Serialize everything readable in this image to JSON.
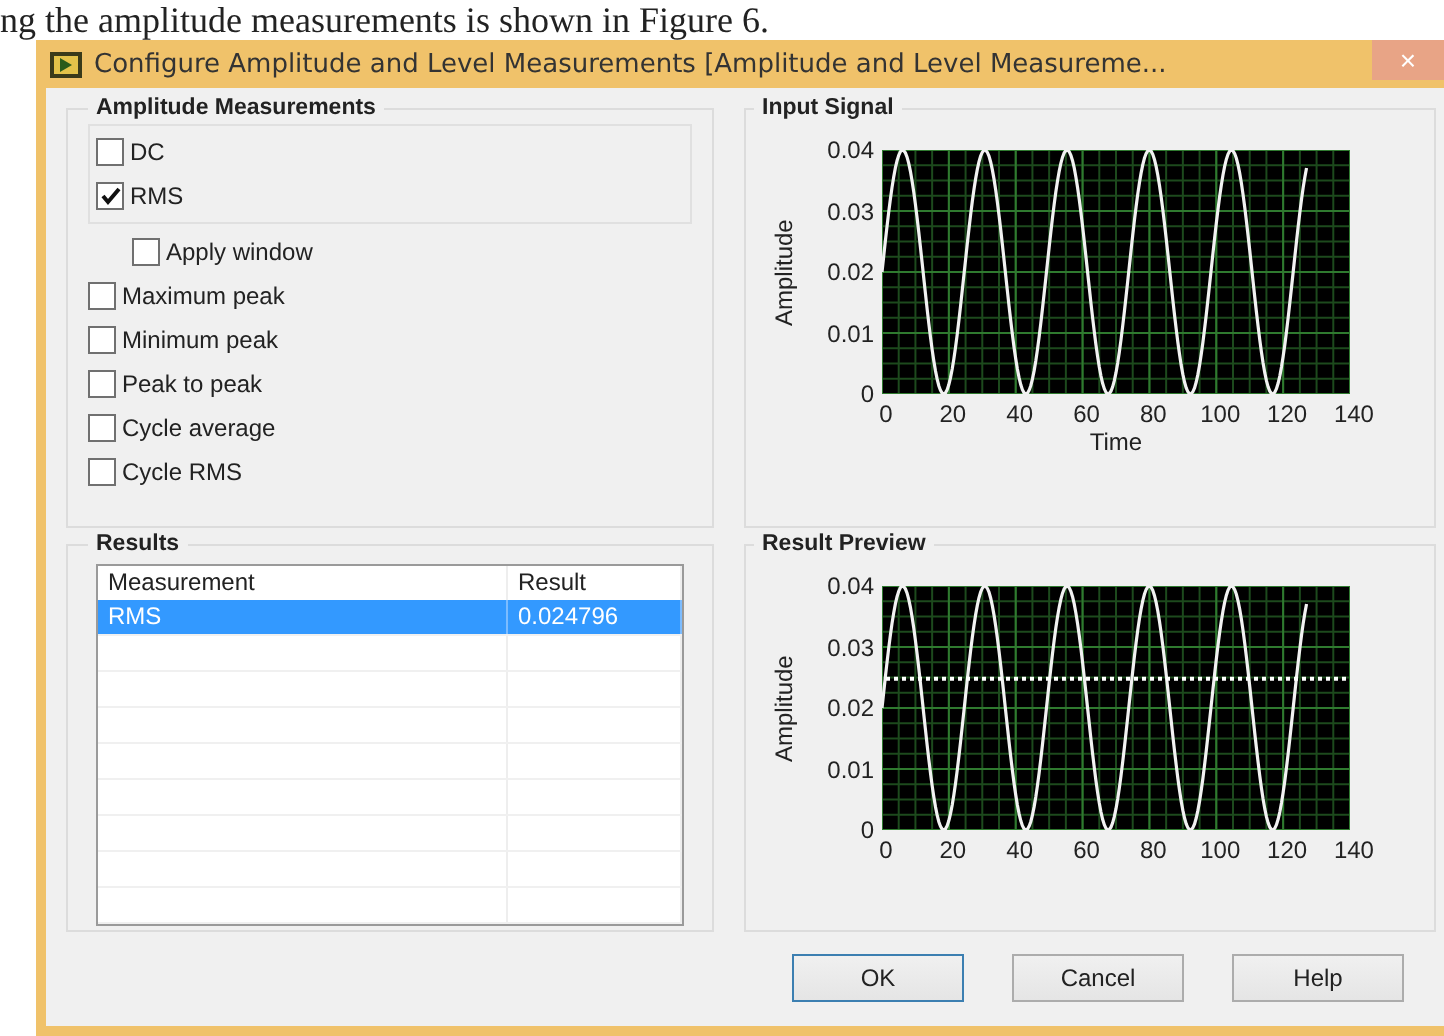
{
  "document_text": "ng the amplitude measurements is shown in Figure 6.",
  "window": {
    "title": "Configure Amplitude and Level Measurements [Amplitude and Level Measureme...",
    "close": "×"
  },
  "amplitude_measurements": {
    "title": "Amplitude Measurements",
    "grouped": [
      {
        "label": "DC",
        "checked": false
      },
      {
        "label": "RMS",
        "checked": true
      }
    ],
    "window_option": {
      "label": "Apply window",
      "checked": false
    },
    "options": [
      {
        "label": "Maximum peak",
        "checked": false
      },
      {
        "label": "Minimum peak",
        "checked": false
      },
      {
        "label": "Peak to peak",
        "checked": false
      },
      {
        "label": "Cycle average",
        "checked": false
      },
      {
        "label": "Cycle RMS",
        "checked": false
      }
    ]
  },
  "results": {
    "title": "Results",
    "columns": [
      "Measurement",
      "Result"
    ],
    "rows": [
      {
        "cells": [
          "RMS",
          "0.024796"
        ],
        "selected": true
      }
    ]
  },
  "graphs": [
    {
      "title": "Input Signal",
      "ylabel": "Amplitude",
      "xlabel": "Time",
      "yticks": [
        "0.04",
        "0.03",
        "0.02",
        "0.01",
        "0"
      ],
      "xticks": [
        "0",
        "20",
        "40",
        "60",
        "80",
        "100",
        "120",
        "140"
      ],
      "result_line": false
    },
    {
      "title": "Result Preview",
      "ylabel": "Amplitude",
      "yticks": [
        "0.04",
        "0.03",
        "0.02",
        "0.01",
        "0"
      ],
      "xticks": [
        "0",
        "20",
        "40",
        "60",
        "80",
        "100",
        "120",
        "140"
      ],
      "result_line": true
    }
  ],
  "buttons": [
    {
      "label": "OK",
      "focused": true
    },
    {
      "label": "Cancel",
      "focused": false
    },
    {
      "label": "Help",
      "focused": false
    }
  ]
}
